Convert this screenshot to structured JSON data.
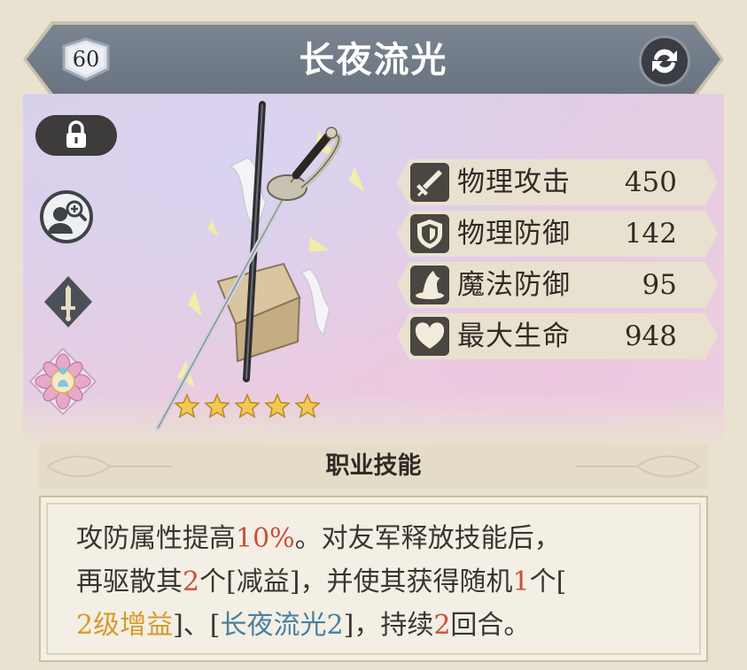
{
  "header": {
    "level": "60",
    "title": "长夜流光"
  },
  "colors": {
    "banner": "#6f7a86",
    "highlight_red": "#c9503c",
    "highlight_orange": "#d79a2b",
    "highlight_blue": "#4a7fa0"
  },
  "icons": {
    "lock": "lock-icon",
    "preview": "character-preview-icon",
    "weapon_type": "sword-class-icon",
    "emblem": "lotus-emblem-icon",
    "swap": "swap-icon"
  },
  "rarity": {
    "stars": 5,
    "max": 5
  },
  "stats": [
    {
      "icon": "sword-icon",
      "label": "物理攻击",
      "value": "450"
    },
    {
      "icon": "shield-icon",
      "label": "物理防御",
      "value": "142"
    },
    {
      "icon": "wizard-hat-icon",
      "label": "魔法防御",
      "value": "95"
    },
    {
      "icon": "heart-icon",
      "label": "最大生命",
      "value": "948"
    }
  ],
  "skill": {
    "title": "职业技能",
    "segments": [
      {
        "text": "攻防属性提高",
        "style": "normal"
      },
      {
        "text": "10%",
        "style": "red"
      },
      {
        "text": "。对友军释放技能后，",
        "style": "normal"
      },
      {
        "text": "再驱散其",
        "style": "normal"
      },
      {
        "text": "2",
        "style": "red"
      },
      {
        "text": "个[减益]，并使其获得随机",
        "style": "normal"
      },
      {
        "text": "1",
        "style": "red"
      },
      {
        "text": "个[",
        "style": "normal"
      },
      {
        "text": "2级增益",
        "style": "orange"
      },
      {
        "text": "]、[",
        "style": "normal"
      },
      {
        "text": "长夜流光2",
        "style": "blue"
      },
      {
        "text": "]，持续",
        "style": "normal"
      },
      {
        "text": "2",
        "style": "red"
      },
      {
        "text": "回合。",
        "style": "normal"
      }
    ]
  }
}
